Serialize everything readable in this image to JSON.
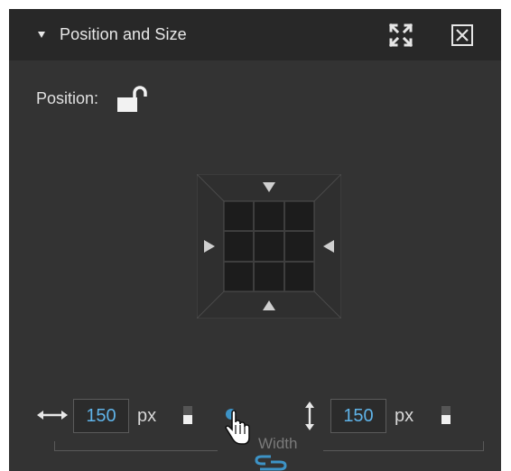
{
  "panel": {
    "title": "Position and Size",
    "icons": {
      "collapse": "caret-down-icon",
      "expand": "expand-arrows-icon",
      "close": "close-box-icon"
    }
  },
  "position": {
    "label": "Position:",
    "lock_icon": "unlocked-padlock-icon"
  },
  "anchor_grid": {
    "rows": 3,
    "cols": 3,
    "arrows": [
      "up",
      "right",
      "left",
      "down"
    ]
  },
  "size": {
    "width": {
      "value": "150",
      "unit": "px"
    },
    "height": {
      "value": "150",
      "unit": "px"
    },
    "tooltip": "Width",
    "link_icon": "chain-link-icon"
  },
  "colors": {
    "panel_bg": "#333333",
    "header_bg": "#282828",
    "accent": "#5fb3e8"
  }
}
